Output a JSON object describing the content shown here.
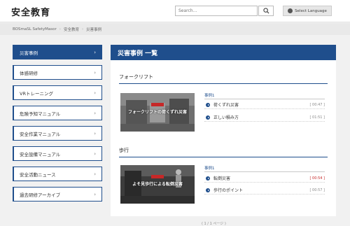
{
  "header": {
    "site_title": "安全教育",
    "search_placeholder": "Search...",
    "lang_button": "Select Language"
  },
  "breadcrumb": [
    "BOSmaSL SafetyMasor",
    "安全教育",
    "災害事例"
  ],
  "sidebar": {
    "items": [
      {
        "label": "災害事例"
      },
      {
        "label": "体感研修"
      },
      {
        "label": "VRトレーニング"
      },
      {
        "label": "危険予知マニュアル"
      },
      {
        "label": "安全作業マニュアル"
      },
      {
        "label": "安全設備マニュアル"
      },
      {
        "label": "安全活動ニュース"
      },
      {
        "label": "過去研修アーカイブ"
      }
    ]
  },
  "main": {
    "title": "災害事例 一覧",
    "sections": [
      {
        "heading": "フォークリフト",
        "thumb_caption": "フォークリフトの荷くずれ災害",
        "case_label": "事例1",
        "rows": [
          {
            "label": "荷くずれ災害",
            "time": "[ 00:47 ]"
          },
          {
            "label": "正しい積み方",
            "time": "[ 01:51 ]"
          }
        ]
      },
      {
        "heading": "歩行",
        "thumb_caption": "よそ見歩行による転倒災害",
        "case_label": "事例1",
        "rows": [
          {
            "label": "転倒災害",
            "time": "[ 00:54 ]"
          },
          {
            "label": "歩行のポイント",
            "time": "[ 00:57 ]"
          }
        ]
      }
    ]
  },
  "footer": {
    "text": "( 1 / 1 ページ )"
  },
  "colors": {
    "primary": "#1f4e8c",
    "accent_red": "#c62828"
  }
}
